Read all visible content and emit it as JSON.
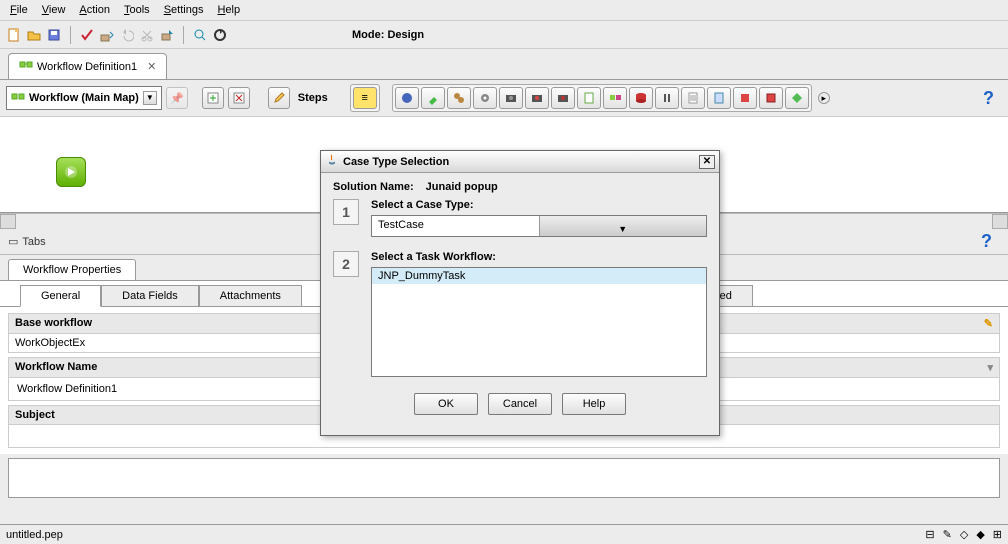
{
  "menu": {
    "file": "File",
    "view": "View",
    "action": "Action",
    "tools": "Tools",
    "settings": "Settings",
    "help": "Help"
  },
  "mode": "Mode: Design",
  "tab": {
    "title": "Workflow Definition1"
  },
  "combo": {
    "label": "Workflow (Main Map)"
  },
  "stepsBtn": "Steps",
  "tabsLabel": "Tabs",
  "propTab": "Workflow Properties",
  "subtabs": {
    "general": "General",
    "datafields": "Data Fields",
    "attachments": "Attachments",
    "advanced": "Advanced"
  },
  "form": {
    "baseWorkflowLabel": "Base workflow",
    "baseWorkflowValue": "WorkObjectEx",
    "workflowNameLabel": "Workflow Name",
    "workflowNameValue": "Workflow Definition1",
    "subjectLabel": "Subject",
    "subjectValue": ""
  },
  "status": {
    "file": "untitled.pep"
  },
  "dialog": {
    "title": "Case Type Selection",
    "solutionNameLabel": "Solution Name:",
    "solutionNameValue": "Junaid popup",
    "step1Label": "Select a Case Type:",
    "caseType": "TestCase",
    "step2Label": "Select a Task Workflow:",
    "taskWorkflow": "JNP_DummyTask",
    "ok": "OK",
    "cancel": "Cancel",
    "help": "Help"
  }
}
